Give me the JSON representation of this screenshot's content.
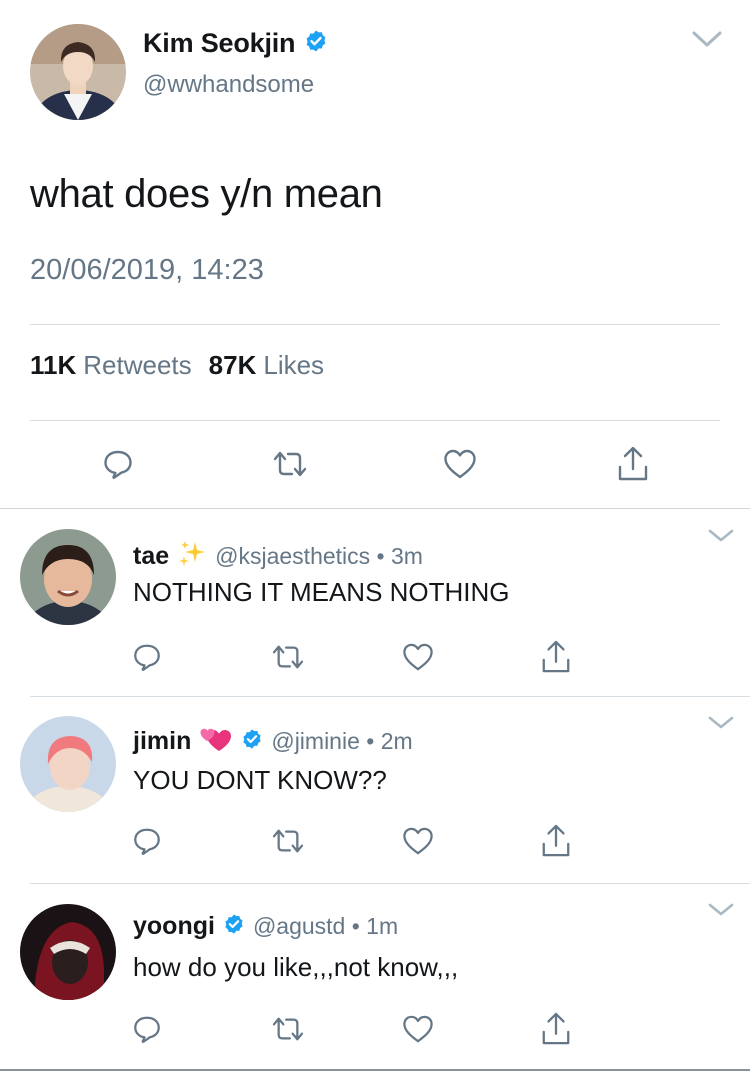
{
  "main_tweet": {
    "author_name": "Kim Seokjin",
    "handle": "@wwhandsome",
    "verified": true,
    "text": "what does y/n mean",
    "timestamp": "20/06/2019, 14:23",
    "retweets_count": "11K",
    "retweets_label": "Retweets",
    "likes_count": "87K",
    "likes_label": "Likes"
  },
  "replies": [
    {
      "name": "tae",
      "emoji": "sparkles",
      "verified": false,
      "meta": "@ksjaesthetics • 3m",
      "text": "NOTHING IT MEANS NOTHING"
    },
    {
      "name": "jimin",
      "emoji": "two-hearts",
      "verified": true,
      "meta": "@jiminie • 2m",
      "text": "YOU DONT KNOW??"
    },
    {
      "name": "yoongi",
      "verified": true,
      "meta": "@agustd • 1m",
      "text": "how do you like,,,not know,,,"
    }
  ],
  "icons": {
    "reply": "comment-bubble-icon",
    "retweet": "retweet-icon",
    "like": "heart-icon",
    "share": "share-icon",
    "more": "chevron-down-icon",
    "verified": "verified-badge-icon"
  },
  "colors": {
    "verified_blue": "#1da1f2",
    "secondary_text": "#657786",
    "primary_text": "#14171a",
    "icon_gray": "#657786"
  }
}
